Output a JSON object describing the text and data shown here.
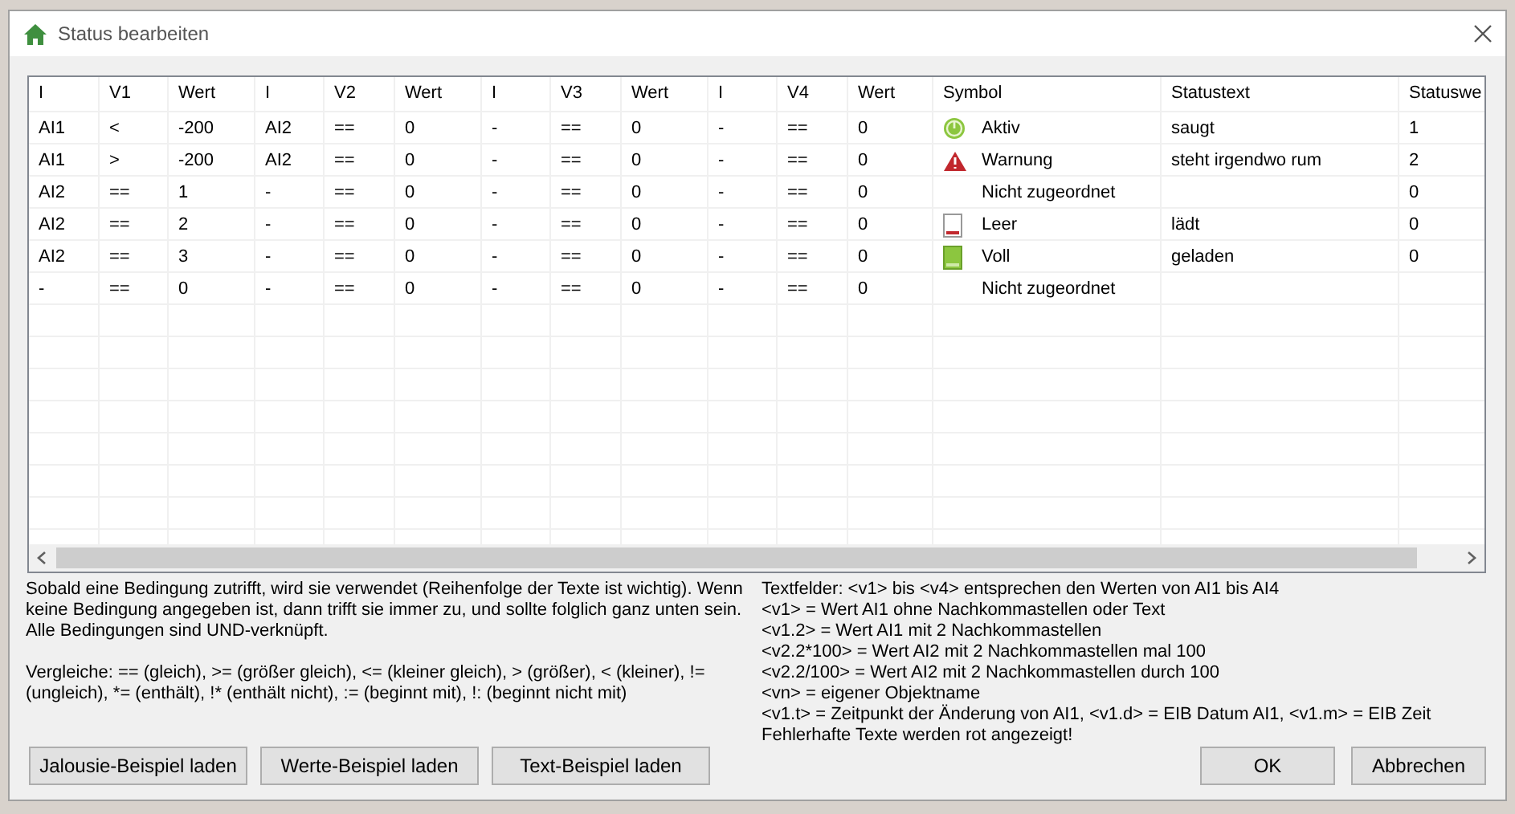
{
  "window": {
    "title": "Status bearbeiten"
  },
  "table": {
    "columns": [
      "I",
      "V1",
      "Wert",
      "I",
      "V2",
      "Wert",
      "I",
      "V3",
      "Wert",
      "I",
      "V4",
      "Wert",
      "Symbol",
      "Statustext",
      "Statuswe"
    ],
    "rows": [
      {
        "conditions": [
          "AI1",
          "<",
          "-200",
          "AI2",
          "==",
          "0",
          "-",
          "==",
          "0",
          "-",
          "==",
          "0"
        ],
        "symbol": {
          "kind": "power",
          "label": "Aktiv"
        },
        "status_text": "saugt",
        "status_value": "1"
      },
      {
        "conditions": [
          "AI1",
          ">",
          "-200",
          "AI2",
          "==",
          "0",
          "-",
          "==",
          "0",
          "-",
          "==",
          "0"
        ],
        "symbol": {
          "kind": "warning",
          "label": "Warnung"
        },
        "status_text": "steht irgendwo rum",
        "status_value": "2"
      },
      {
        "conditions": [
          "AI2",
          "==",
          "1",
          "-",
          "==",
          "0",
          "-",
          "==",
          "0",
          "-",
          "==",
          "0"
        ],
        "symbol": {
          "kind": "none",
          "label": "Nicht zugeordnet"
        },
        "status_value": "0"
      },
      {
        "conditions": [
          "AI2",
          "==",
          "2",
          "-",
          "==",
          "0",
          "-",
          "==",
          "0",
          "-",
          "==",
          "0"
        ],
        "symbol": {
          "kind": "battery-empty",
          "label": "Leer"
        },
        "status_text": "lädt",
        "status_value": "0"
      },
      {
        "conditions": [
          "AI2",
          "==",
          "3",
          "-",
          "==",
          "0",
          "-",
          "==",
          "0",
          "-",
          "==",
          "0"
        ],
        "symbol": {
          "kind": "battery-full",
          "label": "Voll"
        },
        "status_text": "geladen",
        "status_value": "0"
      },
      {
        "conditions": [
          "-",
          "==",
          "0",
          "-",
          "==",
          "0",
          "-",
          "==",
          "0",
          "-",
          "==",
          "0"
        ],
        "symbol": {
          "kind": "none",
          "label": "Nicht zugeordnet"
        }
      }
    ]
  },
  "help_left": [
    [
      "Sobald eine Bedingung zutrifft, wird sie verwendet (Reihenfolge der Texte ist wichtig). Wenn keine Bedingung angegeben ist, dann trifft sie immer zu, und sollte folglich ganz unten sein.",
      "Alle Bedingungen sind UND-verknüpft."
    ],
    [
      "Vergleiche: == (gleich), >= (größer gleich), <= (kleiner gleich), > (größer), < (kleiner), != (ungleich), *= (enthält), !* (enthält nicht), := (beginnt mit), !: (beginnt nicht mit)"
    ]
  ],
  "help_right": [
    "Textfelder: <v1> bis <v4> entsprechen den Werten von AI1 bis AI4",
    "<v1> = Wert AI1 ohne Nachkommastellen oder Text",
    "<v1.2> = Wert AI1 mit 2 Nachkommastellen",
    "<v2.2*100> = Wert AI2 mit 2 Nachkommastellen mal 100",
    "<v2.2/100> = Wert AI2 mit 2 Nachkommastellen durch 100",
    "<vn> = eigener Objektname",
    "<v1.t> = Zeitpunkt der Änderung von AI1, <v1.d> = EIB Datum AI1, <v1.m> = EIB Zeit",
    "Fehlerhafte Texte werden rot angezeigt!"
  ],
  "example_buttons": [
    "Jalousie-Beispiel laden",
    "Werte-Beispiel laden",
    "Text-Beispiel laden"
  ],
  "dialog_buttons": [
    "OK",
    "Abbrechen"
  ]
}
